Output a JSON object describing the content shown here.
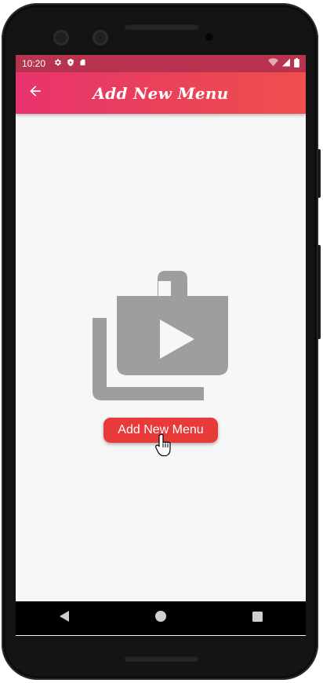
{
  "status_bar": {
    "time": "10:20",
    "left_icons": [
      "gear-icon",
      "shield-icon",
      "sd-card-icon"
    ],
    "right_icons": [
      "wifi-icon",
      "signal-icon",
      "battery-icon"
    ]
  },
  "app_bar": {
    "title": "Add New Menu",
    "back_icon": "arrow-left-icon"
  },
  "empty_state": {
    "illustration_icon": "video-library-icon"
  },
  "add_button": {
    "label": "Add New Menu"
  },
  "nav_bar": {
    "back": "triangle-back-icon",
    "home": "circle-home-icon",
    "recents": "square-recents-icon"
  },
  "colors": {
    "status_bar": "#b8334f",
    "app_bar_start": "#e8336f",
    "app_bar_end": "#ef4f4f",
    "button": "#e93a3a",
    "illustration": "#9e9e9e",
    "screen_background": "#f7f7f7"
  }
}
